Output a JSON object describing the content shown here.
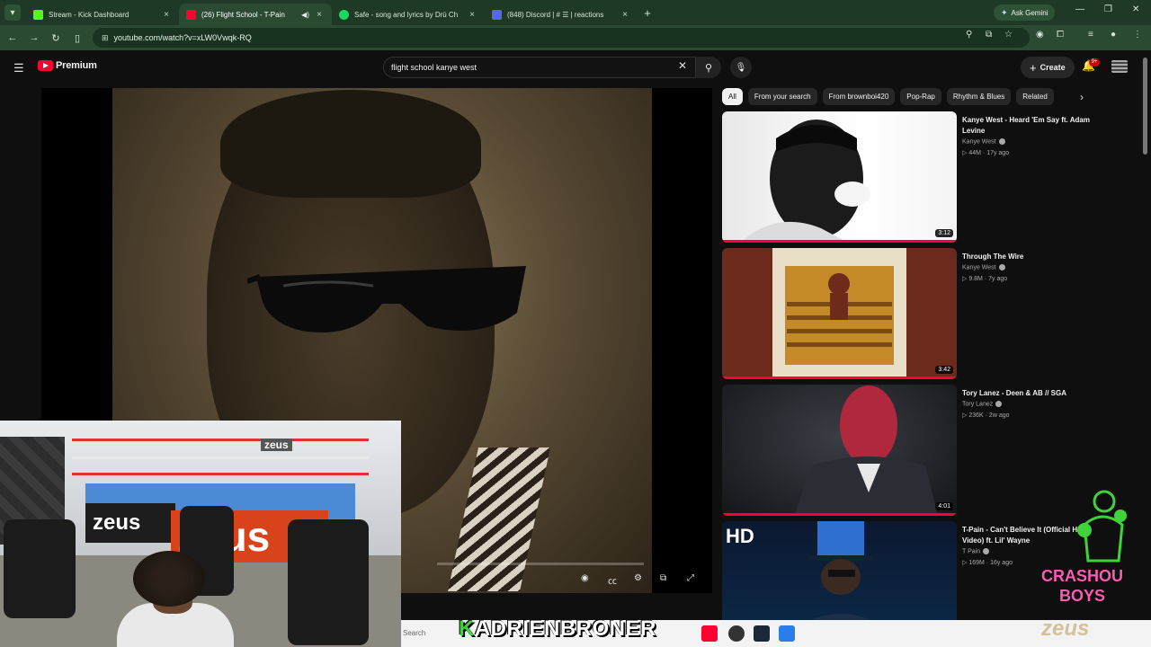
{
  "browser": {
    "tabs": [
      {
        "title": "Stream - Kick Dashboard",
        "color": "#53fc18",
        "active": false
      },
      {
        "title": "(26) Flight School - T-Pain",
        "color": "#ff0033",
        "active": true
      },
      {
        "title": "Safe - song and lyrics by Drū Ch",
        "color": "#1ed760",
        "active": false
      },
      {
        "title": "(848) Discord | # ☰ | reactions",
        "color": "#5865f2",
        "active": false
      }
    ],
    "new_tab": "+",
    "ask_gemini": "Ask Gemini",
    "url": "youtube.com/watch?v=xLW0Vwqk-RQ"
  },
  "youtube": {
    "brand": "Premium",
    "search_query": "flight school kanye west",
    "create_label": "Create",
    "notification_count": "9+",
    "chips": [
      "All",
      "From your search",
      "From brownboi420",
      "Pop-Rap",
      "Rhythm & Blues",
      "Related"
    ],
    "related": [
      {
        "title": "Kanye West - Heard 'Em Say ft. Adam Levine",
        "channel": "Kanye West",
        "views": "44M",
        "age": "17y ago",
        "duration": "3:12"
      },
      {
        "title": "Through The Wire",
        "channel": "Kanye West",
        "views": "9.8M",
        "age": "7y ago",
        "duration": "3:42"
      },
      {
        "title": "Tory Lanez - Deen & AB // SGA",
        "channel": "Tory Lanez",
        "views": "236K",
        "age": "2w ago",
        "duration": "4:01"
      },
      {
        "title": "T-Pain - Can't Believe It (Official HD Video) ft. Lil' Wayne",
        "channel": "T Pain",
        "views": "169M",
        "age": "16y ago",
        "duration": "",
        "badge": "HD"
      }
    ]
  },
  "overlay": {
    "streamer_first": "K",
    "streamer_rest": "ADRIENBRONER",
    "crash_line1": "CRASHOU",
    "crash_line2": "BOYS",
    "sponsor": "zeus",
    "webcam_banner": "zeus",
    "webcam_banner2": "zeus"
  },
  "taskbar": {
    "search_placeholder": "Search"
  },
  "colors": {
    "accent_red": "#ff0033",
    "tabstrip": "#1f3a24",
    "overlay_pink": "#ff5ab4",
    "overlay_green": "#3fd23a"
  }
}
